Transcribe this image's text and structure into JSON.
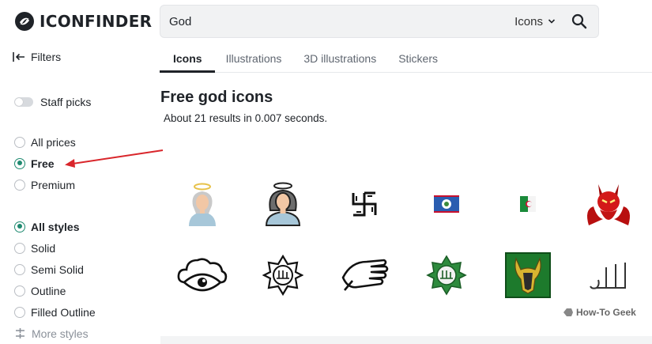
{
  "header": {
    "logo_text": "ICONFINDER",
    "search": {
      "value": "God",
      "type_label": "Icons"
    }
  },
  "filters_label": "Filters",
  "tabs": [
    {
      "label": "Icons",
      "active": true
    },
    {
      "label": "Illustrations",
      "active": false
    },
    {
      "label": "3D illustrations",
      "active": false
    },
    {
      "label": "Stickers",
      "active": false
    }
  ],
  "sidebar": {
    "staff_picks": {
      "label": "Staff picks",
      "on": false
    },
    "prices": [
      {
        "label": "All prices",
        "checked": false
      },
      {
        "label": "Free",
        "checked": true
      },
      {
        "label": "Premium",
        "checked": false
      }
    ],
    "styles": [
      {
        "label": "All styles",
        "checked": true
      },
      {
        "label": "Solid",
        "checked": false
      },
      {
        "label": "Semi Solid",
        "checked": false
      },
      {
        "label": "Outline",
        "checked": false
      },
      {
        "label": "Filled Outline",
        "checked": false
      }
    ],
    "more_styles_label": "More styles"
  },
  "main": {
    "title": "Free god icons",
    "results_text": "About 21 results in 0.007 seconds."
  },
  "icons": [
    {
      "name": "angel-woman-icon"
    },
    {
      "name": "angel-woman-outline-icon"
    },
    {
      "name": "swastika-icon"
    },
    {
      "name": "belize-flag-icon"
    },
    {
      "name": "algeria-flag-icon"
    },
    {
      "name": "devil-icon"
    },
    {
      "name": "eye-cloud-icon"
    },
    {
      "name": "allah-star-outline-icon"
    },
    {
      "name": "praying-hands-icon"
    },
    {
      "name": "allah-star-green-icon"
    },
    {
      "name": "loki-helmet-icon"
    },
    {
      "name": "allah-calligraphy-icon"
    }
  ],
  "watermark": "How-To Geek",
  "colors": {
    "accent": "#1f8a70",
    "arrow": "#d9262b"
  }
}
